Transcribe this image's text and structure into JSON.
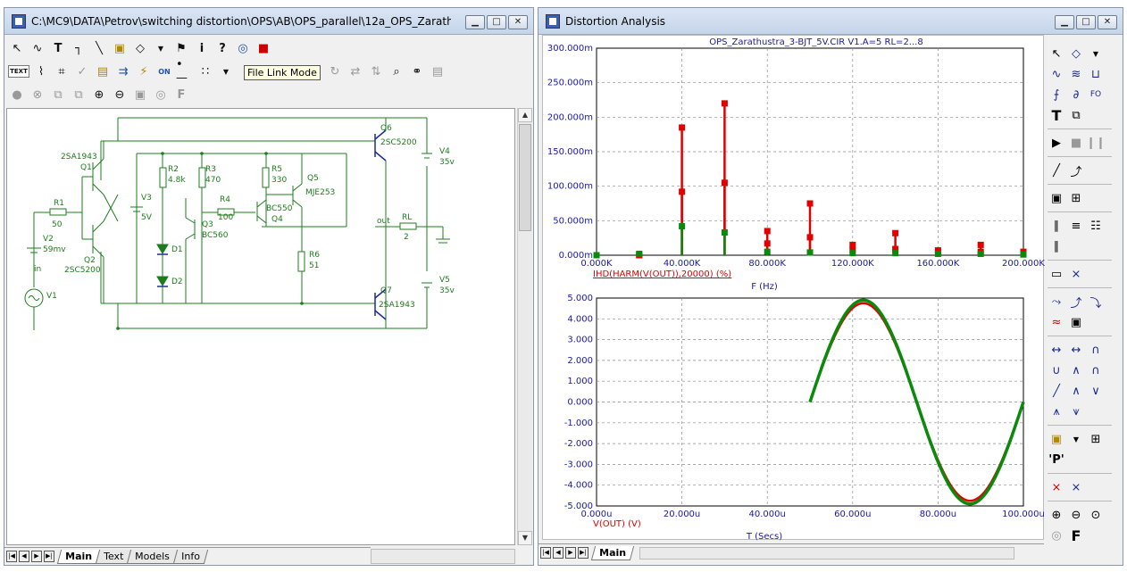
{
  "schematic_window": {
    "title": "C:\\MC9\\DATA\\Petrov\\switching distortion\\OPS\\AB\\OPS_parallel\\12a_OPS_Zarathustra_...",
    "tooltip": "File Link Mode",
    "toolbar1": [
      "select-arrow-icon",
      "wire-icon",
      "text-tool-icon",
      "bus-icon",
      "line-icon",
      "component-icon",
      "flag-icon",
      "info-icon",
      "help-icon",
      "probe-icon",
      "file-link-icon"
    ],
    "toolbar2_text_button": "TEXT",
    "components": {
      "q1": {
        "name": "Q1",
        "model": "2SA1943"
      },
      "q2": {
        "name": "Q2",
        "model": "2SC5200"
      },
      "q3": {
        "name": "Q3",
        "model": "BC560"
      },
      "q4": {
        "name": "Q4",
        "model": "BC550"
      },
      "q5": {
        "name": "Q5",
        "model": "MJE253"
      },
      "q6": {
        "name": "Q6",
        "model": "2SC5200"
      },
      "q7": {
        "name": "Q7",
        "model": "2SA1943"
      },
      "r1": {
        "name": "R1",
        "value": "50"
      },
      "r2": {
        "name": "R2",
        "value": "4.8k"
      },
      "r3": {
        "name": "R3",
        "value": "470"
      },
      "r4": {
        "name": "R4",
        "value": "100"
      },
      "r5": {
        "name": "R5",
        "value": "330"
      },
      "r6": {
        "name": "R6",
        "value": "51"
      },
      "rl": {
        "name": "RL",
        "value": "2"
      },
      "v1": {
        "name": "V1"
      },
      "v2": {
        "name": "V2",
        "value": "59mv"
      },
      "v3": {
        "name": "V3",
        "value": "5V"
      },
      "v4": {
        "name": "V4",
        "value": "35v"
      },
      "v5": {
        "name": "V5",
        "value": "35v"
      },
      "d1": {
        "name": "D1"
      },
      "d2": {
        "name": "D2"
      },
      "node_in": "in",
      "node_out": "out"
    },
    "tabs": [
      "Main",
      "Text",
      "Models",
      "Info"
    ],
    "active_tab": "Main"
  },
  "analysis_window": {
    "title": "Distortion Analysis",
    "tabs": [
      "Main"
    ],
    "active_tab": "Main",
    "colors": {
      "red": "#e00000",
      "green": "#0a8a0a",
      "axis_text": "#1a1aa0",
      "grid": "#8c8c8c"
    }
  },
  "chart_data": [
    {
      "type": "bar",
      "title": "OPS_Zarathustra_3-BJT_5V.CIR V1.A=5 RL=2...8",
      "xlabel": "F (Hz)",
      "ylabel": "",
      "y_expression": "IHD(HARM(V(OUT)),20000) (%)",
      "xlim": [
        0,
        200000
      ],
      "ylim": [
        0,
        300
      ],
      "x_ticks": [
        "0.000K",
        "40.000K",
        "80.000K",
        "120.000K",
        "160.000K",
        "200.000K"
      ],
      "y_ticks": [
        "0.000m",
        "50.000m",
        "100.000m",
        "150.000m",
        "200.000m",
        "250.000m",
        "300.000m"
      ],
      "grid": true,
      "x": [
        0,
        20000,
        40000,
        60000,
        80000,
        100000,
        120000,
        140000,
        160000,
        180000,
        200000
      ],
      "series": [
        {
          "color": "red",
          "values": [
            0,
            0,
            185,
            220,
            35,
            75,
            15,
            32,
            7,
            15,
            5
          ]
        },
        {
          "color": "red",
          "values": [
            0,
            0,
            92,
            105,
            17,
            26,
            8,
            9,
            4,
            5,
            2
          ]
        },
        {
          "color": "green",
          "values": [
            0,
            2,
            42,
            33,
            5,
            4,
            3,
            3,
            2,
            2,
            1
          ]
        }
      ]
    },
    {
      "type": "line",
      "xlabel": "T (Secs)",
      "ylabel": "",
      "y_expression": "V(OUT) (V)",
      "xlim": [
        0,
        100
      ],
      "ylim": [
        -5,
        5
      ],
      "x_ticks": [
        "0.000u",
        "20.000u",
        "40.000u",
        "60.000u",
        "80.000u",
        "100.000u"
      ],
      "y_ticks": [
        "5.000",
        "4.000",
        "3.000",
        "2.000",
        "1.000",
        "0.000",
        "-1.000",
        "-2.000",
        "-3.000",
        "-4.000",
        "-5.000"
      ],
      "grid": true,
      "series": [
        {
          "color": "red",
          "amplitude": 4.75,
          "x_start": 50,
          "x_end": 100,
          "period": 50
        },
        {
          "color": "green",
          "amplitude": 4.9,
          "x_start": 50,
          "x_end": 100,
          "period": 50
        }
      ]
    }
  ],
  "plot_tools": [
    "select-arrow-icon",
    "zoom-tool-icon",
    "scope-icon",
    "waveform-icon",
    "text-tool-icon",
    "copy-icon",
    "run-icon",
    "stop-icon",
    "pause-icon",
    "line-icon",
    "graph-icon",
    "table-icon",
    "cursor-icon",
    "peak-icon",
    "valley-icon",
    "zoom-in-icon",
    "zoom-out-icon",
    "zoom-fit-icon",
    "font-icon"
  ],
  "plot_tool_labels": {
    "text": "T",
    "pvar": "'P'",
    "font": "F"
  }
}
